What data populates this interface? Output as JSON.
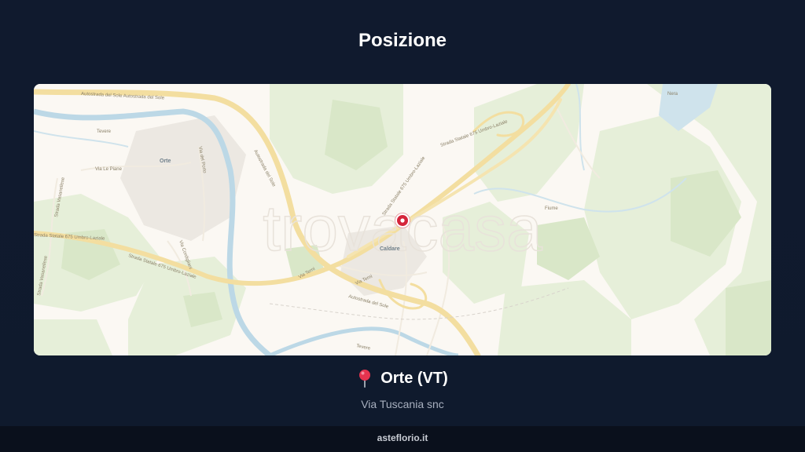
{
  "page": {
    "title": "Posizione"
  },
  "map": {
    "watermark": "trovacasa",
    "marker": {
      "icon": "location-marker-icon",
      "color": "#d5253b"
    },
    "labels": {
      "town_orte": "Orte",
      "town_caldare": "Caldare",
      "via_le_piane": "Via Le Piane",
      "via_del_porto": "Via del Porto",
      "strada_vasanellese_top": "Strada Vasanellese",
      "strada_vasanellese_bottom": "Strada Vasanellese",
      "via_cordigliani": "Via Cordigliani",
      "via_terni_left": "Via Terni",
      "via_terni_right": "Via Terni",
      "autostrada_top": "Autostrada del Sole  Autostrada del Sole",
      "autostrada_diag": "Autostrada del Sole",
      "autostrada_bottom": "Autostrada del Sole",
      "ss675_left": "Strada Statale 675 Umbro-Laziale",
      "ss675_mid": "Strada Statale 675 Umbro-Laziale",
      "ss675_right": "Strada Statale 675 Umbro-Laziale",
      "ss675_diag": "Strada Statale 675 Umbro-Laziale",
      "tevere_top": "Tevere",
      "tevere_bottom": "Tevere",
      "nera": "Nera",
      "fiume": "Fiume"
    }
  },
  "location": {
    "city": "Orte (VT)",
    "address": "Via Tuscania snc",
    "pin_icon": "pushpin-icon"
  },
  "footer": {
    "site": "asteflorio.it"
  }
}
